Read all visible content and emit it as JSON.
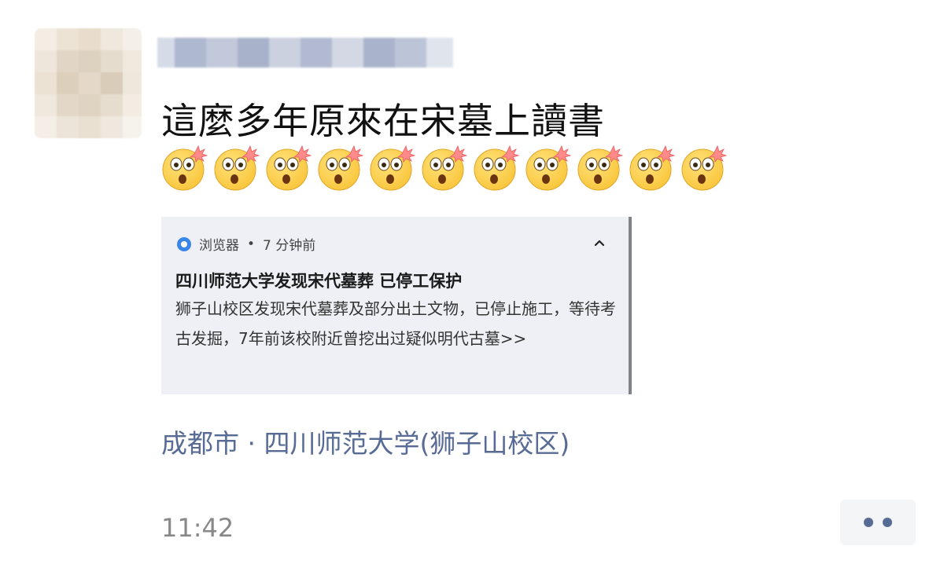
{
  "post": {
    "text": "這麼多年原來在宋墓上讀書",
    "emoji_count": 11,
    "emoji_icon": "astonished-exploding-face-icon"
  },
  "notification": {
    "app_name": "浏览器",
    "separator": "•",
    "time_ago": "7 分钟前",
    "title": "四川师范大学发现宋代墓葬 已停工保护",
    "body": "狮子山校区发现宋代墓葬及部分出土文物，已停止施工，等待考古发掘，7年前该校附近曾挖出过疑似明代古墓>>",
    "app_icon": "browser-icon",
    "collapse_icon": "chevron-up-icon"
  },
  "location": "成都市 · 四川师范大学(狮子山校区)",
  "timestamp": "11:42",
  "colors": {
    "link": "#576b95",
    "card_bg": "#eef0f5",
    "emoji_face": "#f9c53a"
  }
}
